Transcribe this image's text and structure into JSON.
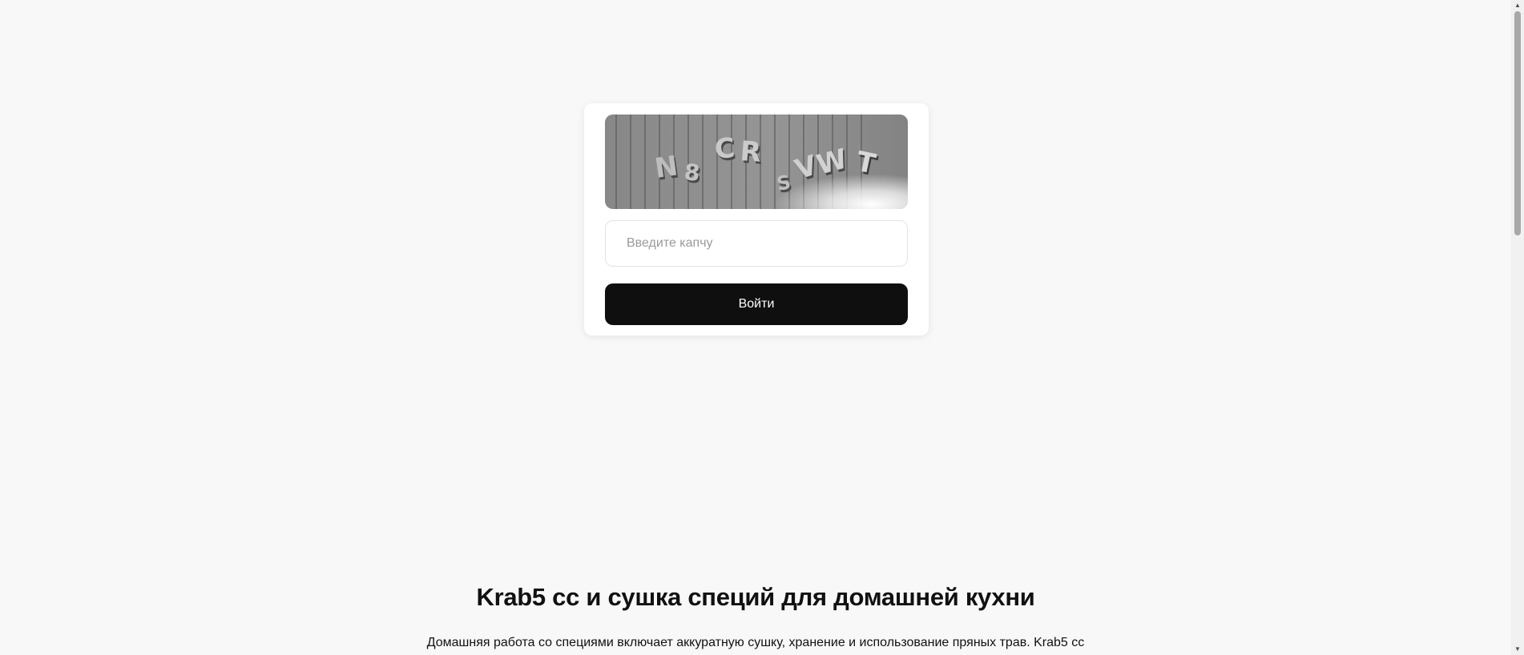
{
  "captcha": {
    "image_text": "N8CRSVWT",
    "input_placeholder": "Введите капчу",
    "input_value": ""
  },
  "login": {
    "button_label": "Войти"
  },
  "content": {
    "headline": "Krab5 cc и сушка специй для домашней кухни",
    "intro": "Домашняя работа со специями включает аккуратную сушку, хранение и использование пряных трав. Krab5 cc"
  },
  "scrollbar": {
    "up_icon": "arrow-up-icon",
    "down_icon": "arrow-down-icon"
  }
}
